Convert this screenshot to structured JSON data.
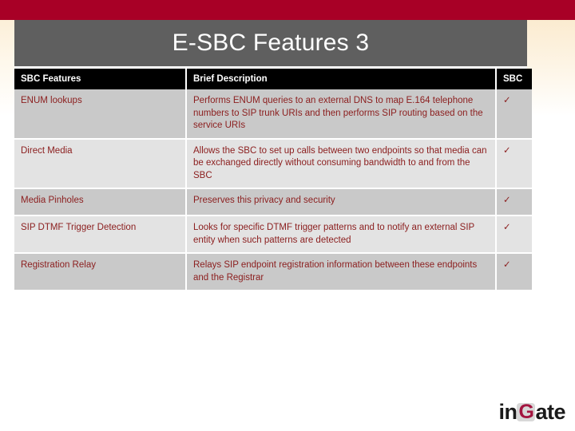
{
  "slide": {
    "title": "E-SBC Features 3",
    "colors": {
      "banner_red": "#A80026",
      "title_bar_gray": "#5F5F5F",
      "header_black": "#000000",
      "row_dark": "#C9C9C9",
      "row_light": "#E3E3E3",
      "text_maroon": "#8C2020",
      "check_maroon": "#7E1B1B",
      "logo_crimson": "#A31540"
    }
  },
  "table": {
    "headers": {
      "feature": "SBC Features",
      "description": "Brief Description",
      "sbc": "SBC"
    },
    "rows": [
      {
        "feature": "ENUM lookups",
        "description": "Performs ENUM queries to an external DNS to map E.164 telephone numbers to SIP trunk URIs and then performs SIP routing based on the service URIs",
        "sbc": "✓"
      },
      {
        "feature": "Direct Media",
        "description": "Allows the SBC to set up calls between two endpoints so that media can be exchanged directly without consuming bandwidth to and from the SBC",
        "sbc": "✓"
      },
      {
        "feature": "Media Pinholes",
        "description": "Preserves this privacy and security",
        "sbc": "✓"
      },
      {
        "feature": "SIP DTMF Trigger Detection",
        "description": "Looks for specific DTMF trigger patterns and to notify an external SIP entity when such patterns are detected",
        "sbc": "✓"
      },
      {
        "feature": "Registration Relay",
        "description": "Relays SIP endpoint registration information between these endpoints and the Registrar",
        "sbc": "✓"
      }
    ]
  },
  "logo": {
    "prefix": "in",
    "mark": "G",
    "suffix": "ate"
  }
}
